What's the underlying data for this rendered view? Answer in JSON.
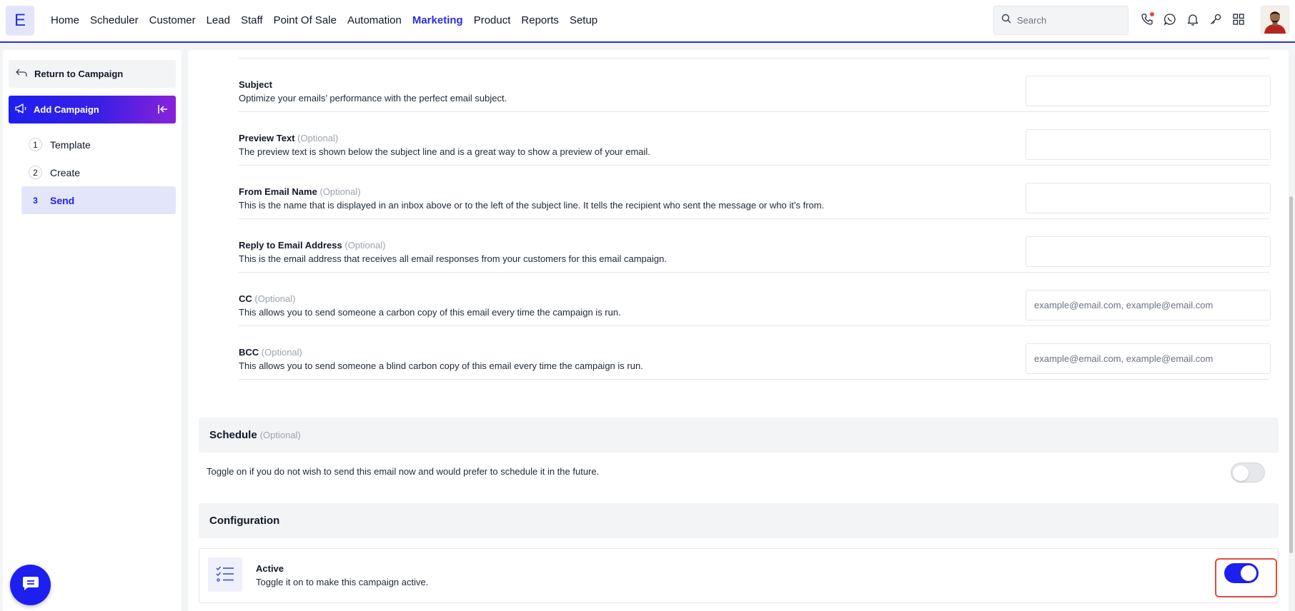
{
  "app": {
    "logo_letter": "E"
  },
  "nav": {
    "items": [
      "Home",
      "Scheduler",
      "Customer",
      "Lead",
      "Staff",
      "Point Of Sale",
      "Automation",
      "Marketing",
      "Product",
      "Reports",
      "Setup"
    ],
    "active": "Marketing",
    "search_placeholder": "Search",
    "icons": [
      "phone-icon",
      "whatsapp-icon",
      "bell-icon",
      "key-icon",
      "apps-grid-icon"
    ]
  },
  "sidebar": {
    "return_label": "Return to Campaign",
    "add_campaign_label": "Add Campaign",
    "steps": [
      {
        "num": "1",
        "label": "Template"
      },
      {
        "num": "2",
        "label": "Create"
      },
      {
        "num": "3",
        "label": "Send"
      }
    ],
    "current_step": 3
  },
  "form": {
    "optional_label": "(Optional)",
    "fields": [
      {
        "title": "Subject",
        "optional": false,
        "description": "Optimize your emails’ performance with the perfect email subject.",
        "value": "",
        "placeholder": ""
      },
      {
        "title": "Preview Text",
        "optional": true,
        "description": "The preview text is shown below the subject line and is a great way to show a preview of your email.",
        "value": "",
        "placeholder": ""
      },
      {
        "title": "From Email Name",
        "optional": true,
        "description": "This is the name that is displayed in an inbox above or to the left of the subject line. It tells the recipient who sent the message or who it’s from.",
        "value": "",
        "placeholder": ""
      },
      {
        "title": "Reply to Email Address",
        "optional": true,
        "description": "This is the email address that receives all email responses from your customers for this email campaign.",
        "value": "",
        "placeholder": ""
      },
      {
        "title": "CC",
        "optional": true,
        "description": "This allows you to send someone a carbon copy of this email every time the campaign is run.",
        "value": "",
        "placeholder": "example@email.com, example@email.com"
      },
      {
        "title": "BCC",
        "optional": true,
        "description": "This allows you to send someone a blind carbon copy of this email every time the campaign is run.",
        "value": "",
        "placeholder": "example@email.com, example@email.com"
      }
    ]
  },
  "schedule": {
    "title": "Schedule",
    "optional_label": "(Optional)",
    "description": "Toggle on if you do not wish to send this email now and would prefer to schedule it in the future.",
    "enabled": false
  },
  "configuration": {
    "title": "Configuration",
    "active_title": "Active",
    "active_description": "Toggle it on to make this campaign active.",
    "active_enabled": true
  },
  "colors": {
    "accent": "#1d1ff0",
    "highlight": "#e04b3f"
  }
}
